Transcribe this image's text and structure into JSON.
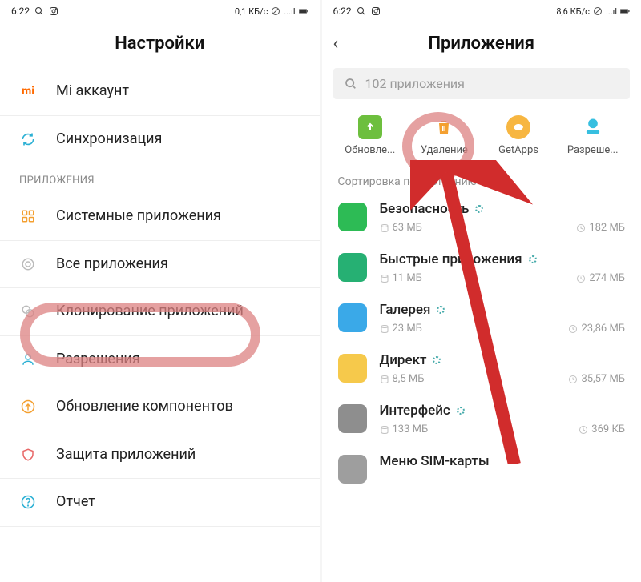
{
  "left": {
    "status": {
      "time": "6:22",
      "net": "0,1 КБ/с"
    },
    "title": "Настройки",
    "section_label": "ПРИЛОЖЕНИЯ",
    "rows_top": [
      {
        "id": "mi-account",
        "label": "Mi аккаунт"
      },
      {
        "id": "sync",
        "label": "Синхронизация"
      }
    ],
    "rows_apps": [
      {
        "id": "system-apps",
        "label": "Системные приложения"
      },
      {
        "id": "all-apps",
        "label": "Все приложения"
      },
      {
        "id": "clone-apps",
        "label": "Клонирование приложений"
      },
      {
        "id": "permissions",
        "label": "Разрешения"
      },
      {
        "id": "components",
        "label": "Обновление компонентов"
      },
      {
        "id": "app-protect",
        "label": "Защита приложений"
      },
      {
        "id": "report",
        "label": "Отчет"
      }
    ]
  },
  "right": {
    "status": {
      "time": "6:22",
      "net": "8,6 КБ/с"
    },
    "title": "Приложения",
    "search_placeholder": "102 приложения",
    "actions": [
      {
        "id": "updates",
        "label": "Обновле...",
        "color": "#6dbf3e"
      },
      {
        "id": "uninstall",
        "label": "Удаление",
        "color": "#f4a031"
      },
      {
        "id": "getapps",
        "label": "GetApps",
        "color": "#f7b641"
      },
      {
        "id": "permissions",
        "label": "Разреше...",
        "color": "#37bfe0"
      }
    ],
    "sort_label": "Сортировка по состоянию",
    "apps": [
      {
        "name": "Безопасность",
        "size": "63 МБ",
        "time": "182 МБ",
        "color": "#2dbb55"
      },
      {
        "name": "Быстрые приложения",
        "size": "11 МБ",
        "time": "274 МБ",
        "color": "#26b073"
      },
      {
        "name": "Галерея",
        "size": "23 МБ",
        "time": "23,86 МБ",
        "color": "#3aa9e8"
      },
      {
        "name": "Директ",
        "size": "8,5 МБ",
        "time": "35,57 МБ",
        "color": "#f6c94b"
      },
      {
        "name": "Интерфейс",
        "size": "133 МБ",
        "time": "369 КБ",
        "color": "#8e8e8e"
      },
      {
        "name": "Меню SIM-карты",
        "size": "",
        "time": "",
        "color": "#9e9e9e"
      }
    ]
  }
}
